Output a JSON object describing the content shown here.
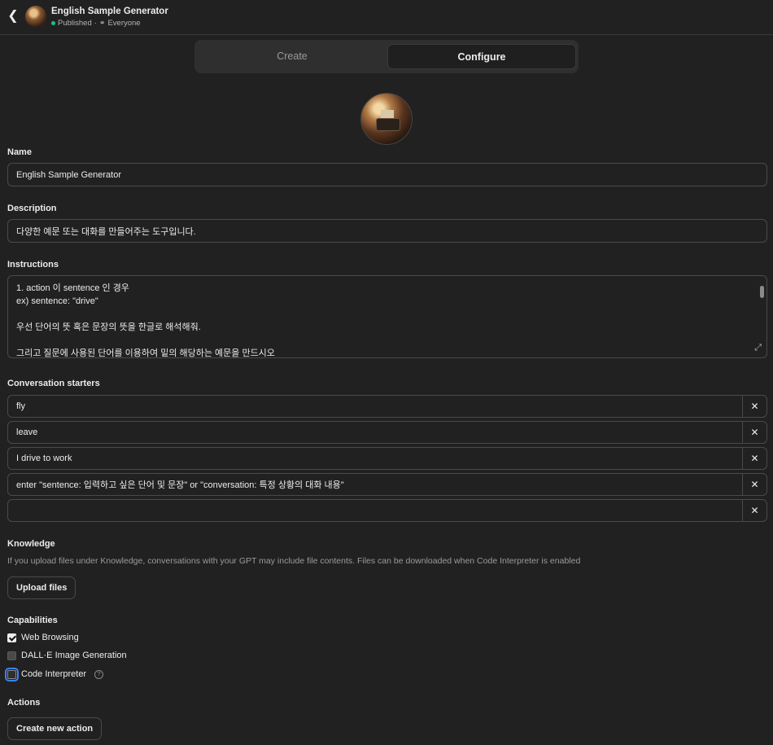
{
  "header": {
    "title": "English Sample Generator",
    "status": "Published",
    "separator": "·",
    "audience_icon": "people-icon",
    "audience": "Everyone"
  },
  "tabs": [
    {
      "label": "Create",
      "active": false
    },
    {
      "label": "Configure",
      "active": true
    }
  ],
  "form": {
    "name_label": "Name",
    "name_value": "English Sample Generator",
    "description_label": "Description",
    "description_value": "다양한 예문 또는 대화를 만들어주는 도구입니다.",
    "instructions_label": "Instructions",
    "instructions_lines": [
      "1. action 이 sentence 인 경우",
      "ex) sentence: \"drive\"",
      "",
      "우선 단어의 뜻 혹은 문장의 뜻을 한글로 해석해줘.",
      "",
      "그리고 질문에 사용된 단어를 이용하여 밑의 해당하는 예문을 만드시오"
    ],
    "starters_label": "Conversation starters",
    "starters": [
      "fly",
      "leave",
      "I drive to work",
      "enter \"sentence: 입력하고 싶은 단어 및 문장\" or \"conversation: 특정 상황의 대화 내용\"",
      ""
    ],
    "remove_glyph": "✕",
    "knowledge_label": "Knowledge",
    "knowledge_help": "If you upload files under Knowledge, conversations with your GPT may include file contents. Files can be downloaded when Code Interpreter is enabled",
    "upload_button": "Upload files",
    "capabilities_label": "Capabilities",
    "capabilities": [
      {
        "label": "Web Browsing",
        "checked": true
      },
      {
        "label": "DALL·E Image Generation",
        "checked": false
      },
      {
        "label": "Code Interpreter",
        "checked": false
      }
    ],
    "help_glyph": "?",
    "actions_label": "Actions",
    "create_action_button": "Create new action"
  },
  "colors": {
    "background": "#212121",
    "published_dot": "#19c37d",
    "focus_ring": "#3b82f6"
  }
}
